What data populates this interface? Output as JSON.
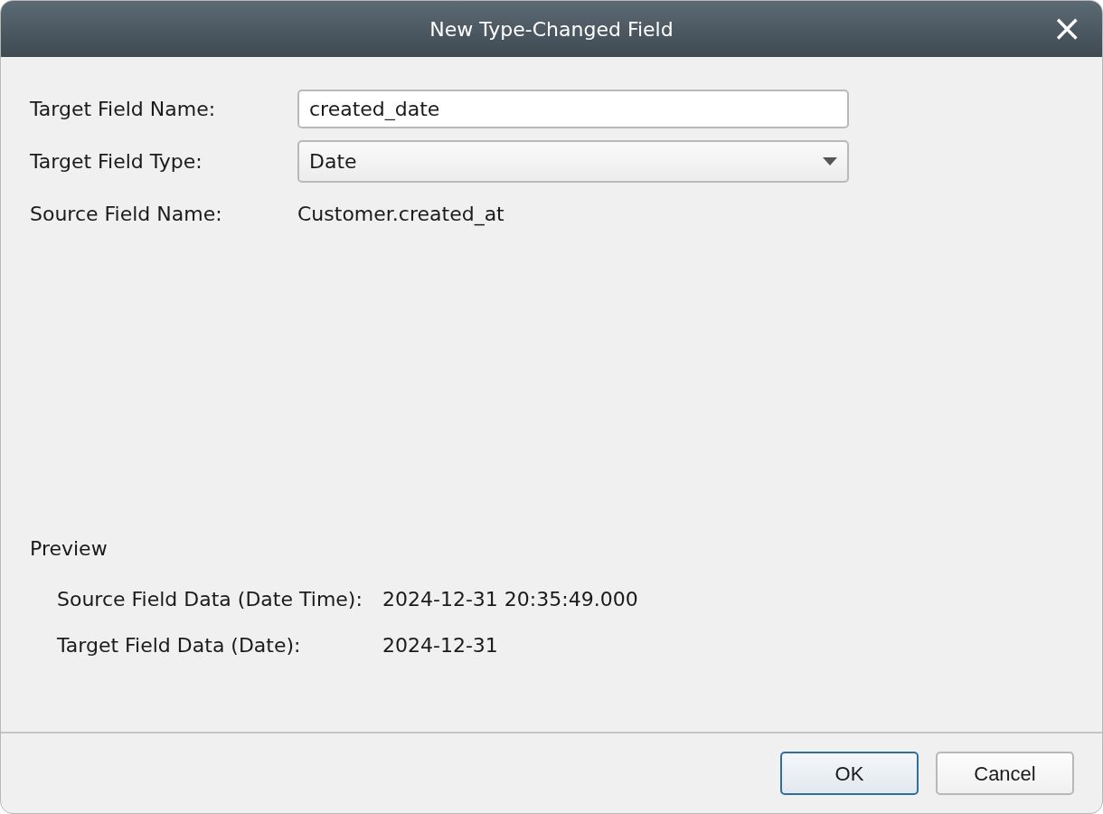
{
  "window": {
    "title": "New Type-Changed Field",
    "close": "×"
  },
  "form": [
    {
      "kind": "input",
      "label": "Target Field Name:",
      "value": "created_date"
    },
    {
      "kind": "select",
      "label": "Target Field Type:",
      "value": "Date"
    },
    {
      "kind": "text",
      "label": "Source Field Name:",
      "value": "Customer.created_at"
    }
  ],
  "preview": {
    "title": "Preview",
    "rows": [
      {
        "label": "Source Field Data (Date Time):",
        "value": "2024-12-31 20:35:49.000"
      },
      {
        "label": "Target Field Data (Date):",
        "value": "2024-12-31"
      }
    ]
  },
  "buttons": [
    {
      "label": "OK",
      "default": true
    },
    {
      "label": "Cancel",
      "default": false
    }
  ]
}
